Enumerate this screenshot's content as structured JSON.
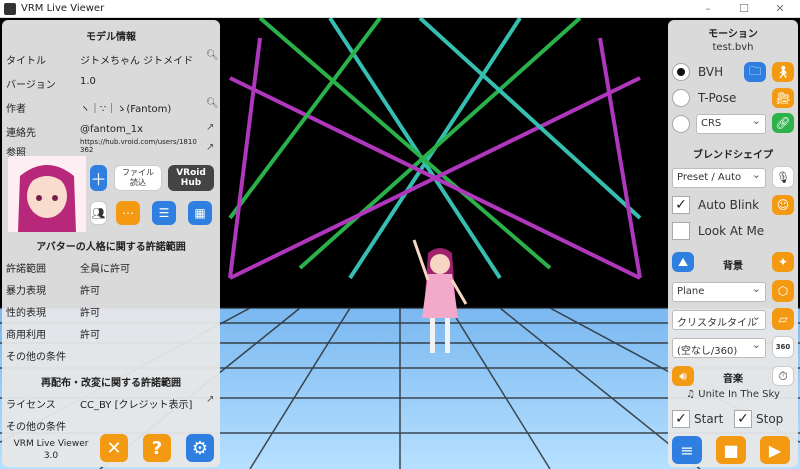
{
  "window": {
    "title": "VRM Live Viewer"
  },
  "model_info": {
    "title": "モデル情報",
    "rows": [
      {
        "label": "タイトル",
        "value": "ジトメちゃん ジトメイド"
      },
      {
        "label": "バージョン",
        "value": "1.0"
      },
      {
        "label": "作者",
        "value": "ヽ｜∵｜ゝ(Fantom)"
      },
      {
        "label": "連絡先",
        "value": "@fantom_1x"
      },
      {
        "label": "参照",
        "value": "https://hub.vroid.com/users/1810362"
      }
    ],
    "file_button": "ファイル\n読込",
    "vroid_button": "VRoid\nHub"
  },
  "persona": {
    "title": "アバターの人格に関する許諾範囲",
    "rows": [
      {
        "label": "許諾範囲",
        "value": "全員に許可"
      },
      {
        "label": "暴力表現",
        "value": "許可"
      },
      {
        "label": "性的表現",
        "value": "許可"
      },
      {
        "label": "商用利用",
        "value": "許可"
      },
      {
        "label": "その他の条件",
        "value": ""
      }
    ]
  },
  "redistribution": {
    "title": "再配布・改変に関する許諾範囲",
    "rows": [
      {
        "label": "ライセンス",
        "value": "CC_BY [クレジット表示]"
      },
      {
        "label": "その他の条件",
        "value": ""
      }
    ]
  },
  "app_version": "VRM Live Viewer\n3.0",
  "motion": {
    "title": "モーション",
    "file": "test.bvh",
    "bvh_label": "BVH",
    "tpose_label": "T-Pose",
    "crs_value": "CRS"
  },
  "blend": {
    "title": "ブレンドシェイプ",
    "preset_value": "Preset / Auto",
    "auto_blink": "Auto Blink",
    "look_at_me": "Look At Me"
  },
  "background": {
    "title": "背景",
    "plane_value": "Plane",
    "tile_value": "クリスタルタイル",
    "sky_value": "(空なし/360)"
  },
  "music": {
    "title": "音楽",
    "track": "♫ Unite In The Sky",
    "start_label": "Start",
    "stop_label": "Stop"
  }
}
